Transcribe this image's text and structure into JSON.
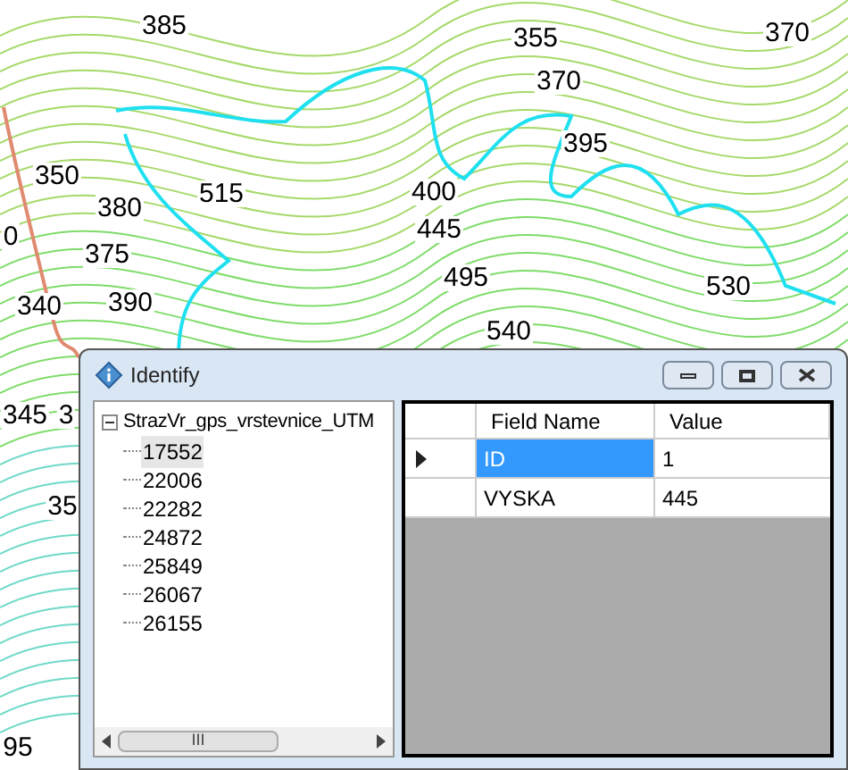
{
  "map": {
    "labels": [
      "385",
      "355",
      "370",
      "370",
      "395",
      "350",
      "515",
      "400",
      "380",
      "445",
      "0",
      "375",
      "495",
      "530",
      "340",
      "390",
      "540",
      "345",
      "3",
      "35",
      "95"
    ]
  },
  "window": {
    "title": "Identify"
  },
  "tree": {
    "root": {
      "label": "StrazVr_gps_vrstevnice_UTM",
      "expanded": true,
      "children": [
        {
          "label": "17552",
          "selected": true
        },
        {
          "label": "22006",
          "selected": false
        },
        {
          "label": "22282",
          "selected": false
        },
        {
          "label": "24872",
          "selected": false
        },
        {
          "label": "25849",
          "selected": false
        },
        {
          "label": "26067",
          "selected": false
        },
        {
          "label": "26155",
          "selected": false
        }
      ]
    },
    "scrollbar": {
      "thumb": "III"
    }
  },
  "table": {
    "columns": [
      "Field Name",
      "Value"
    ],
    "rows": [
      {
        "field": "ID",
        "value": "1",
        "selected": true
      },
      {
        "field": "VYSKA",
        "value": "445",
        "selected": false
      }
    ]
  }
}
